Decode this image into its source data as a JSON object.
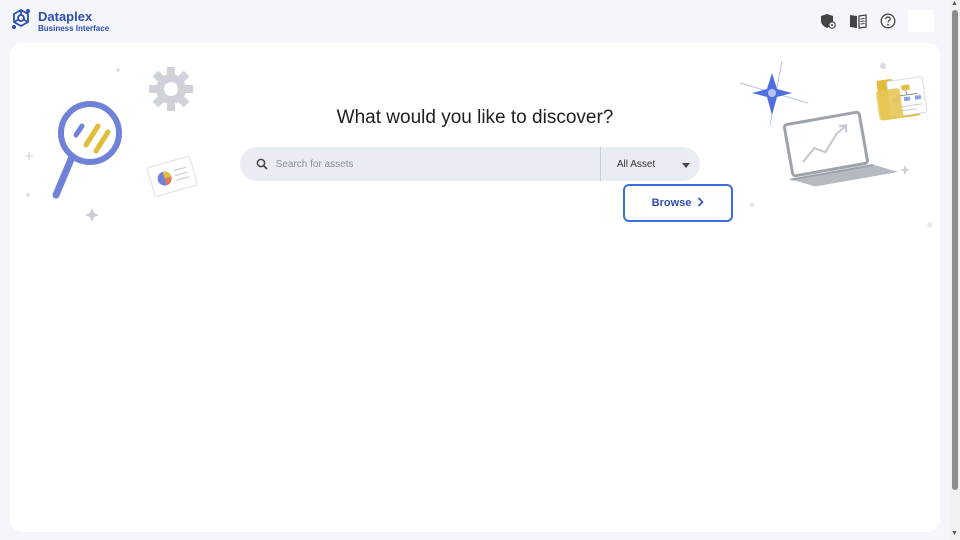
{
  "brand": {
    "title": "Dataplex",
    "subtitle": "Business Interface",
    "logo_icon": "dataplex-logo-icon",
    "accent": "#2f4db3"
  },
  "topbar": {
    "icons": [
      "admin-shield-icon",
      "book-icon",
      "help-icon"
    ],
    "avatar": "avatar"
  },
  "main": {
    "headline": "What would you like to discover?",
    "search": {
      "placeholder": "Search for assets",
      "value": ""
    },
    "asset_filter": {
      "selected": "All Asset"
    },
    "browse_label": "Browse"
  },
  "colors": {
    "page_bg": "#f4f6fb",
    "card_bg": "#ffffff",
    "search_bg": "#e9ecf3",
    "browse_border": "#3b6fe0"
  }
}
